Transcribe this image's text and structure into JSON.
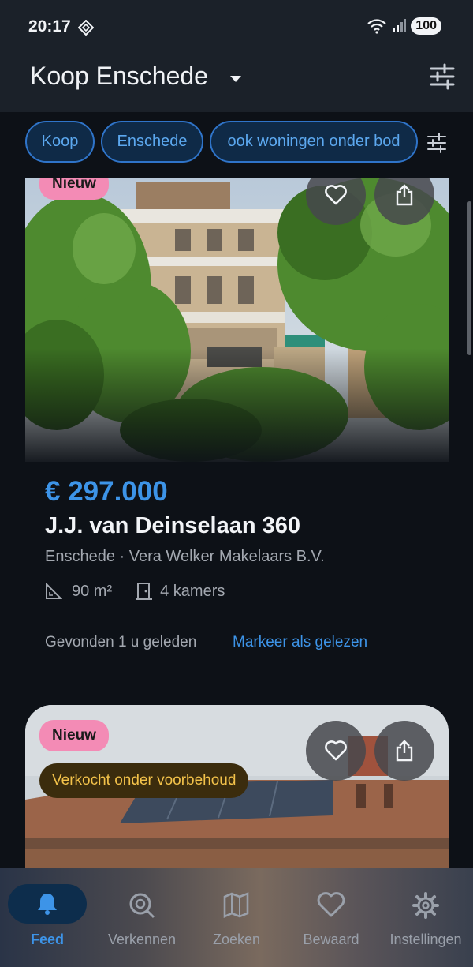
{
  "status_bar": {
    "time": "20:17",
    "battery": "100"
  },
  "app_bar": {
    "title": "Koop Enschede"
  },
  "filters": {
    "chips": [
      "Koop",
      "Enschede",
      "ook woningen onder bod"
    ]
  },
  "listings": [
    {
      "badge": "Nieuw",
      "price": "€ 297.000",
      "address": "J.J. van Deinselaan 360",
      "location": "Enschede · Vera Welker Makelaars B.V.",
      "area": "90 m²",
      "rooms": "4 kamers",
      "found": "Gevonden 1 u geleden",
      "mark_read": "Markeer als gelezen"
    },
    {
      "badge": "Nieuw",
      "status_badge": "Verkocht onder voorbehoud"
    }
  ],
  "bottom_nav": {
    "items": [
      {
        "label": "Feed",
        "icon": "bell-icon",
        "active": true
      },
      {
        "label": "Verkennen",
        "icon": "explore-icon",
        "active": false
      },
      {
        "label": "Zoeken",
        "icon": "map-search-icon",
        "active": false
      },
      {
        "label": "Bewaard",
        "icon": "heart-icon",
        "active": false
      },
      {
        "label": "Instellingen",
        "icon": "gear-icon",
        "active": false
      }
    ]
  },
  "colors": {
    "accent": "#3d94e8",
    "badge_new": "#f38bb5",
    "sold_text": "#f3c24a",
    "background": "#0d1117"
  }
}
